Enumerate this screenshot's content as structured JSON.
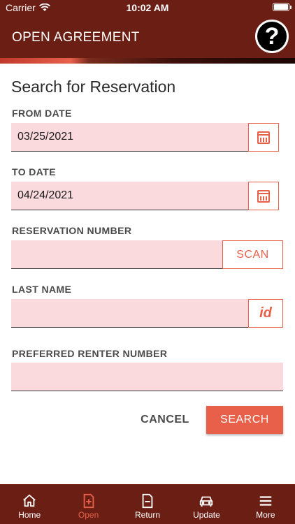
{
  "status_bar": {
    "carrier": "Carrier",
    "time": "10:02 AM"
  },
  "header": {
    "title": "OPEN AGREEMENT",
    "help_symbol": "?"
  },
  "page": {
    "heading": "Search for Reservation"
  },
  "form": {
    "from_date": {
      "label": "FROM DATE",
      "value": "03/25/2021"
    },
    "to_date": {
      "label": "TO DATE",
      "value": "04/24/2021"
    },
    "reservation_number": {
      "label": "RESERVATION NUMBER",
      "value": "",
      "button_label": "SCAN"
    },
    "last_name": {
      "label": "LAST NAME",
      "value": "",
      "button_label": "id"
    },
    "preferred_renter_number": {
      "label": "PREFERRED RENTER NUMBER",
      "value": ""
    }
  },
  "actions": {
    "cancel_label": "CANCEL",
    "search_label": "SEARCH"
  },
  "tabs": [
    {
      "label": "Home",
      "icon": "home-icon",
      "active": false
    },
    {
      "label": "Open",
      "icon": "open-plus-icon",
      "active": true
    },
    {
      "label": "Return",
      "icon": "return-minus-icon",
      "active": false
    },
    {
      "label": "Update",
      "icon": "car-icon",
      "active": false
    },
    {
      "label": "More",
      "icon": "menu-icon",
      "active": false
    }
  ],
  "colors": {
    "brand": "#6b1f14",
    "accent": "#e8604a",
    "field_bg": "#fadadd"
  }
}
